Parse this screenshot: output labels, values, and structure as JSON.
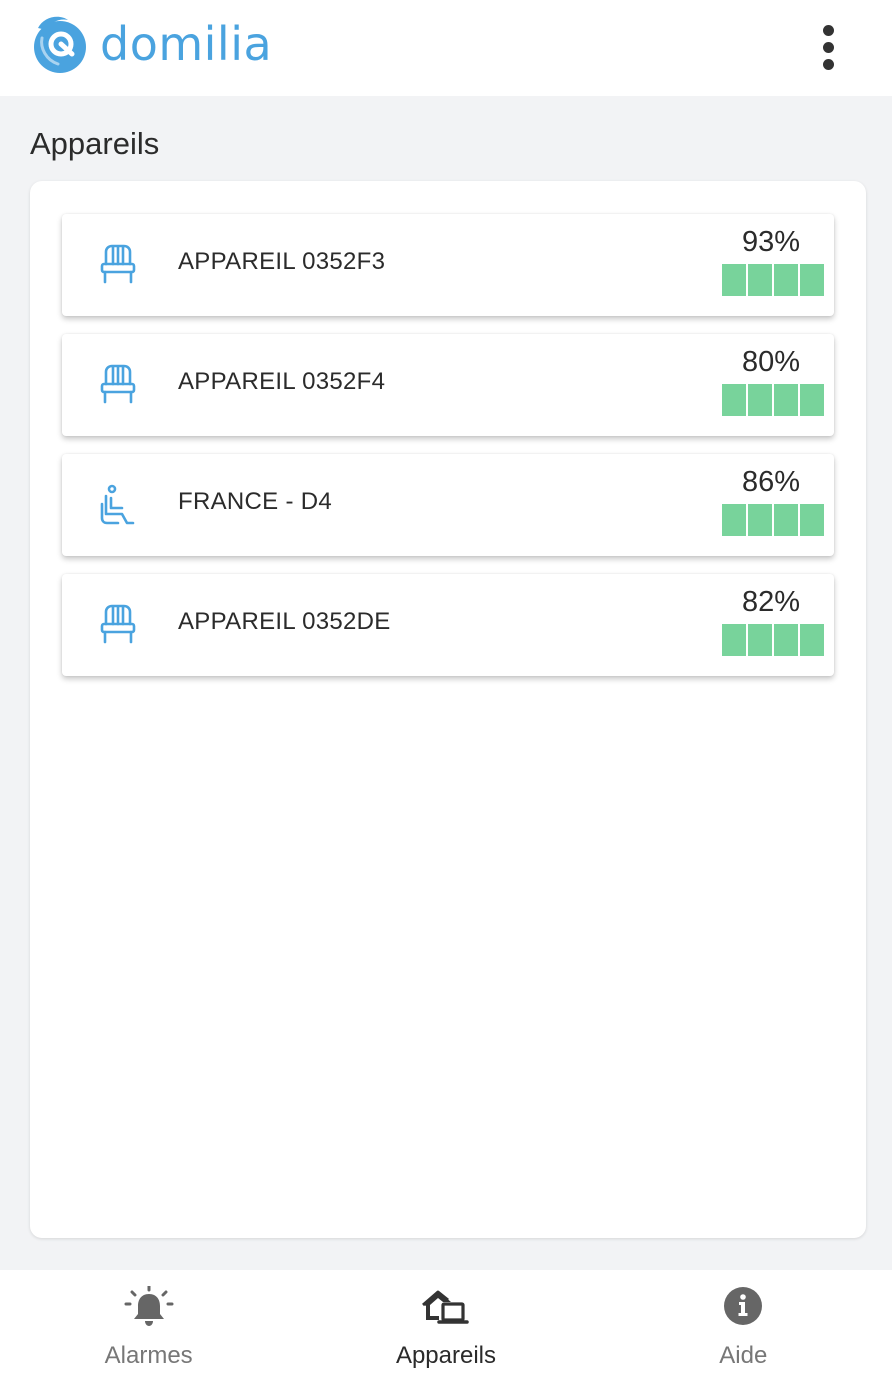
{
  "app": {
    "brand": "domilia",
    "brand_color": "#4aa3df",
    "menu_icon": "more-vert-icon"
  },
  "page": {
    "title": "Appareils"
  },
  "devices": [
    {
      "name": "APPAREIL 0352F3",
      "icon": "chair-icon",
      "battery_text": "93%",
      "battery_level_percent": 93,
      "battery_color": "#78d39b"
    },
    {
      "name": "APPAREIL 0352F4",
      "icon": "chair-icon",
      "battery_text": "80%",
      "battery_level_percent": 80,
      "battery_color": "#78d39b"
    },
    {
      "name": "FRANCE - D4",
      "icon": "wheelchair-icon",
      "battery_text": "86%",
      "battery_level_percent": 86,
      "battery_color": "#78d39b"
    },
    {
      "name": "APPAREIL 0352DE",
      "icon": "chair-icon",
      "battery_text": "82%",
      "battery_level_percent": 82,
      "battery_color": "#78d39b"
    }
  ],
  "bottom_nav": {
    "items": [
      {
        "label": "Alarmes",
        "icon": "alarm-bell-icon",
        "active": false
      },
      {
        "label": "Appareils",
        "icon": "devices-home-icon",
        "active": true
      },
      {
        "label": "Aide",
        "icon": "info-icon",
        "active": false
      }
    ]
  }
}
